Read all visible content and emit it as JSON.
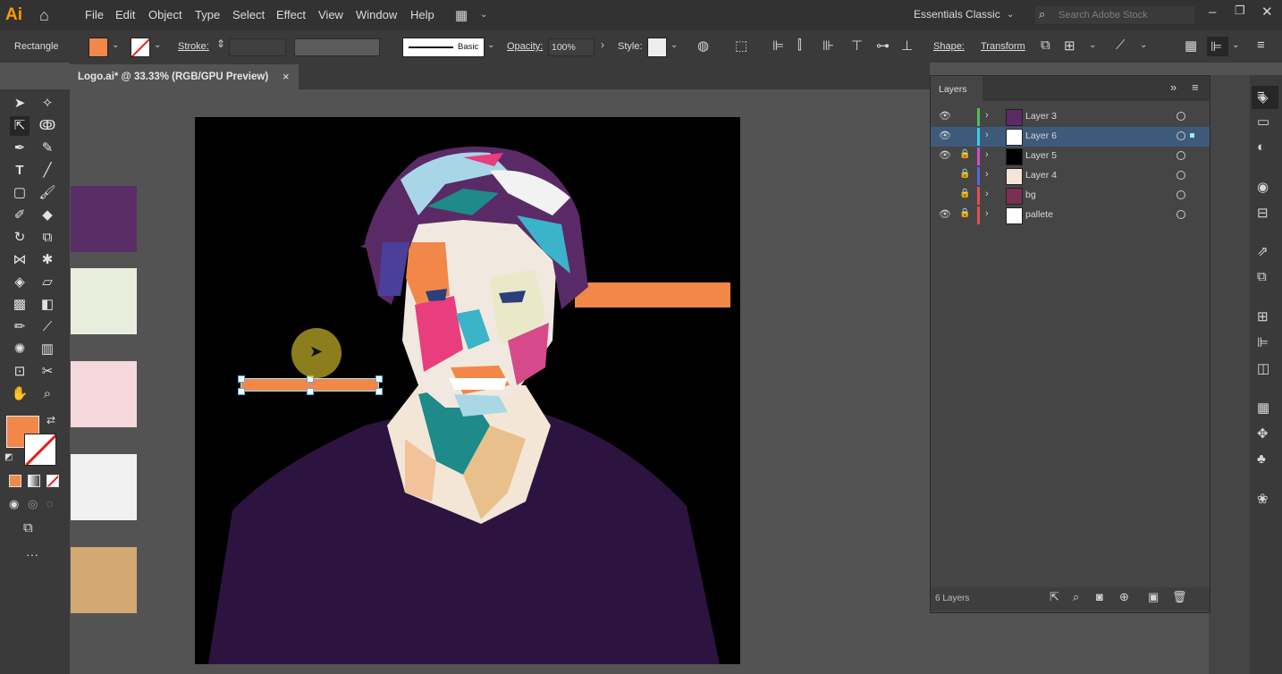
{
  "app": {
    "logo": "Ai"
  },
  "menu": [
    "File",
    "Edit",
    "Object",
    "Type",
    "Select",
    "Effect",
    "View",
    "Window",
    "Help"
  ],
  "workspace": {
    "label": "Essentials Classic",
    "search_placeholder": "Search Adobe Stock"
  },
  "control": {
    "object_type": "Rectangle",
    "fill_color": "#f2874a",
    "stroke_label": "Stroke:",
    "brush_label": "Basic",
    "opacity_label": "Opacity:",
    "opacity_value": "100%",
    "style_label": "Style:",
    "shape_label": "Shape:",
    "transform_label": "Transform"
  },
  "document": {
    "tab_title": "Logo.ai* @ 33.33% (RGB/GPU Preview)",
    "close_glyph": "×"
  },
  "swatches": [
    {
      "color": "#5b2d66"
    },
    {
      "color": "#e9eddb"
    },
    {
      "color": "#f4d8dc"
    },
    {
      "color": "#f1f1f1"
    },
    {
      "color": "#d3a873"
    }
  ],
  "layers": {
    "panel_title": "Layers",
    "count_label": "6 Layers",
    "items": [
      {
        "name": "Layer 3",
        "visible": true,
        "locked": false,
        "bar": "#4ebd5a",
        "selected": false
      },
      {
        "name": "Layer 6",
        "visible": true,
        "locked": false,
        "bar": "#3ad0df",
        "selected": true
      },
      {
        "name": "Layer 5",
        "visible": true,
        "locked": true,
        "bar": "#d04ccb",
        "selected": false
      },
      {
        "name": "Layer 4",
        "visible": false,
        "locked": true,
        "bar": "#5566e8",
        "selected": false
      },
      {
        "name": "bg",
        "visible": false,
        "locked": true,
        "bar": "#e05050",
        "selected": false
      },
      {
        "name": "pallete",
        "visible": true,
        "locked": true,
        "bar": "#e05050",
        "selected": false
      }
    ]
  },
  "colors": {
    "accent_fill": "#f2874a",
    "selection": "#3d5a7a"
  }
}
